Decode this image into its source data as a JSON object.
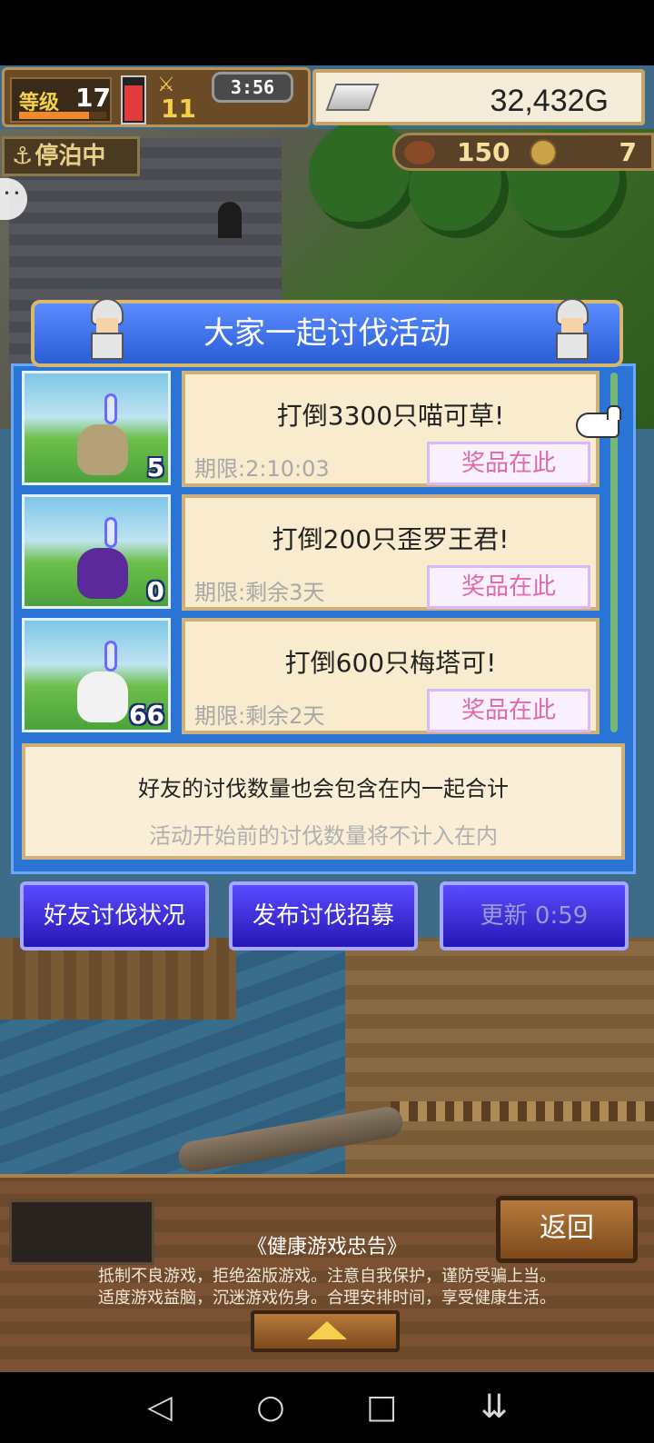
{
  "hud": {
    "level_label": "等级",
    "level": "17",
    "level_xp_fraction": 0.8,
    "hp_fraction": 0.85,
    "secondary_value": "11",
    "timer": "3:56",
    "gold": "32,432G",
    "status": "停泊中",
    "food": "150",
    "coins": "7"
  },
  "dialog": {
    "title": "大家一起讨伐活动",
    "missions": [
      {
        "title": "打倒3300只喵可草!",
        "deadline": "期限:2:10:03",
        "prize_label": "奖品在此",
        "count": "5",
        "monster_color": "#b5a178"
      },
      {
        "title": "打倒200只歪罗王君!",
        "deadline": "期限:剩余3天",
        "prize_label": "奖品在此",
        "count": "0",
        "monster_color": "#5a2a9a"
      },
      {
        "title": "打倒600只梅塔可!",
        "deadline": "期限:剩余2天",
        "prize_label": "奖品在此",
        "count": "66",
        "monster_color": "#f2f2f2"
      }
    ],
    "note_main": "好友的讨伐数量也会包含在内一起合计",
    "note_sub": "活动开始前的讨伐数量将不计入在内",
    "buttons": {
      "friend_status": "好友讨伐状况",
      "post_recruit": "发布讨伐招募",
      "refresh": "更新 0:59"
    }
  },
  "bottom": {
    "back_label": "返回",
    "health_title": "《健康游戏忠告》",
    "health_line1": "抵制不良游戏，拒绝盗版游戏。注意自我保护，谨防受骗上当。",
    "health_line2": "适度游戏益脑，沉迷游戏伤身。合理安排时间，享受健康生活。"
  },
  "navbar": {
    "back_icon": "◁",
    "home_icon": "○",
    "recent_icon": "□",
    "down_icon": "⇊"
  }
}
